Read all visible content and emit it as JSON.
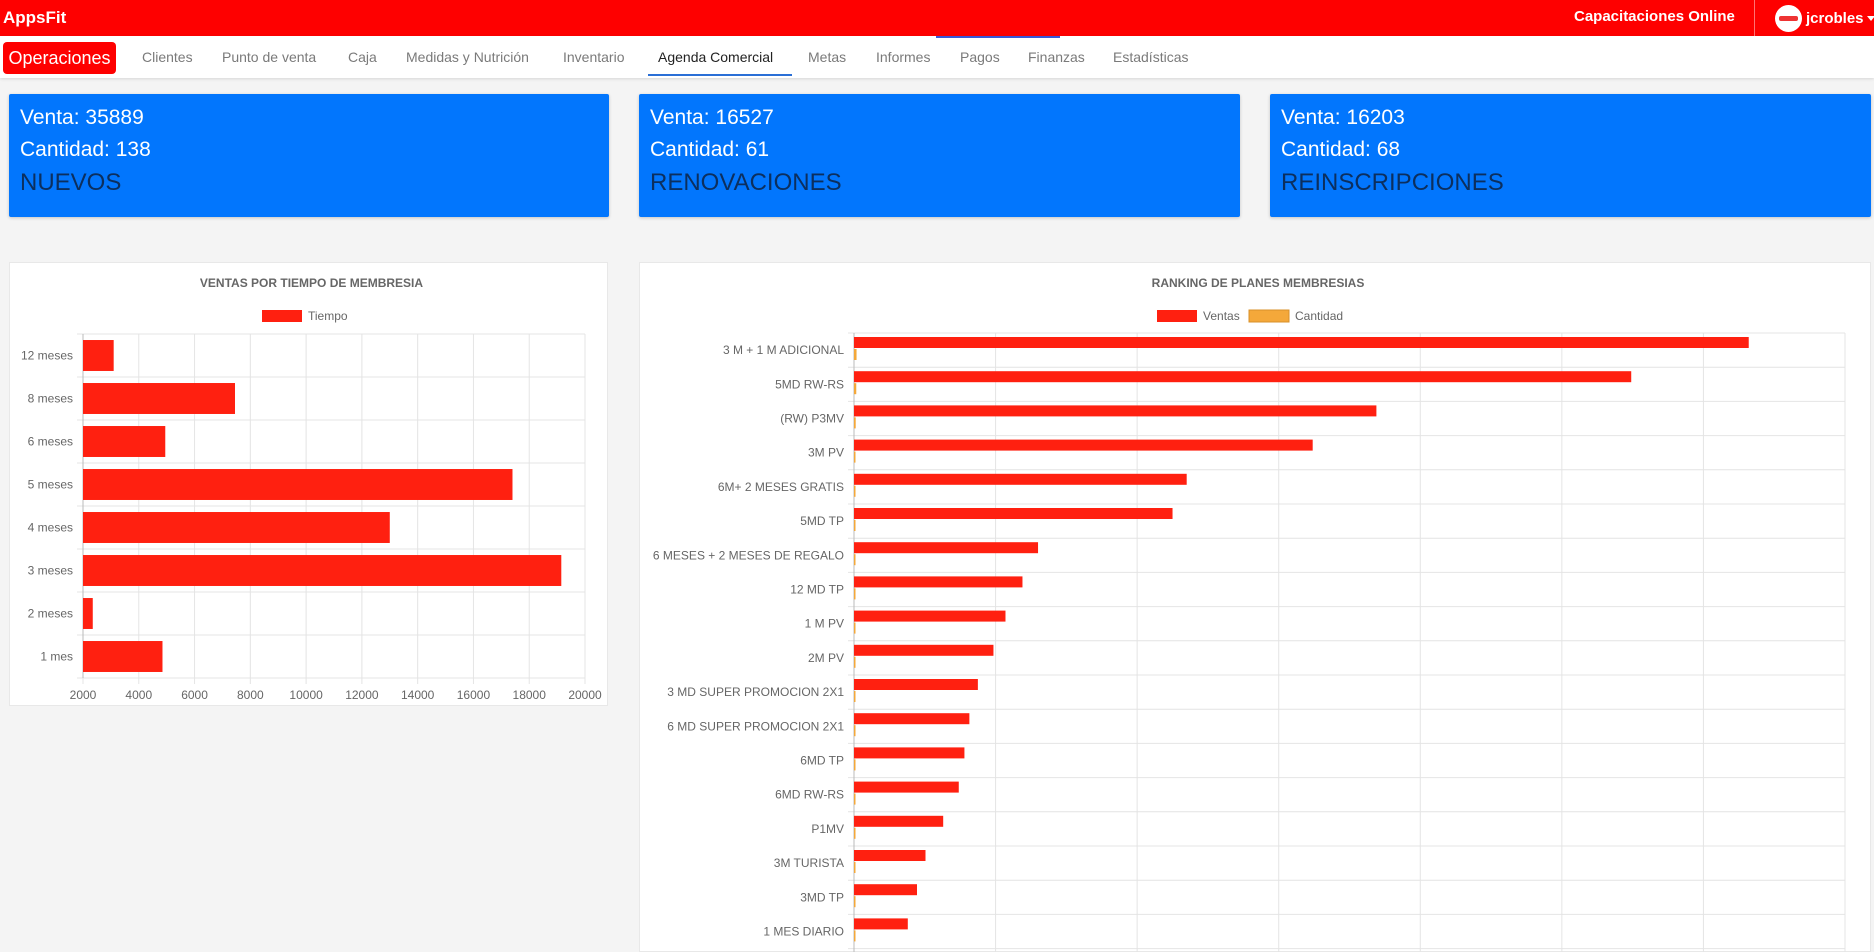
{
  "app": {
    "brand": "AppsFit"
  },
  "header": {
    "training_link": "Capacitaciones Online",
    "user_name": "jcrobles"
  },
  "nav": {
    "primary": "Operaciones",
    "items": [
      "Clientes",
      "Punto de venta",
      "Caja",
      "Medidas y Nutrición",
      "Inventario",
      "Agenda Comercial",
      "Metas",
      "Informes",
      "Pagos",
      "Finanzas",
      "Estadísticas"
    ],
    "active": "Agenda Comercial"
  },
  "cards": [
    {
      "venta": "Venta: 35889",
      "cantidad": "Cantidad: 138",
      "label": "NUEVOS"
    },
    {
      "venta": "Venta: 16527",
      "cantidad": "Cantidad: 61",
      "label": "RENOVACIONES"
    },
    {
      "venta": "Venta: 16203",
      "cantidad": "Cantidad: 68",
      "label": "REINSCRIPCIONES"
    }
  ],
  "colors": {
    "topbar": "#fe0000",
    "card": "#0276fd",
    "bar_ventas": "#ff2010",
    "bar_cantidad": "#f4a83a"
  },
  "chart_data": [
    {
      "type": "bar",
      "orientation": "horizontal",
      "title": "VENTAS POR TIEMPO DE MEMBRESIA",
      "categories": [
        "12 meses",
        "8 meses",
        "6  meses",
        "5 meses",
        "4 meses",
        "3 meses",
        "2 meses",
        "1 mes"
      ],
      "series": [
        {
          "name": "Tiempo",
          "values": [
            3100,
            7450,
            4950,
            17400,
            13000,
            19150,
            2350,
            4850
          ]
        }
      ],
      "xlim": [
        2000,
        20000
      ],
      "xticks": [
        "2000",
        "4000",
        "6000",
        "8000",
        "10000",
        "12000",
        "14000",
        "16000",
        "18000",
        "20000"
      ],
      "grid": true,
      "legend": "top"
    },
    {
      "type": "bar",
      "orientation": "horizontal",
      "title": "RANKING DE PLANES MEMBRESIAS",
      "categories": [
        "3 M + 1 M ADICIONAL",
        "5MD RW-RS",
        "(RW) P3MV",
        "3M PV",
        "6M+ 2 MESES GRATIS",
        "5MD TP",
        "6 MESES + 2 MESES DE REGALO",
        "12 MD TP",
        "1 M PV",
        "2M PV",
        "3  MD SUPER PROMOCION 2X1",
        "6  MD SUPER PROMOCION 2X1",
        "6MD TP",
        "6MD RW-RS",
        "P1MV",
        "3M TURISTA",
        "3MD TP",
        "1 MES DIARIO"
      ],
      "series": [
        {
          "name": "Ventas",
          "values": [
            6320,
            5490,
            3690,
            3240,
            2350,
            2250,
            1300,
            1190,
            1070,
            985,
            875,
            815,
            780,
            740,
            630,
            505,
            445,
            380
          ]
        },
        {
          "name": "Cantidad",
          "values": [
            18,
            16,
            12,
            10,
            7,
            6,
            5,
            4,
            4,
            3,
            3,
            3,
            3,
            3,
            2,
            2,
            2,
            2
          ]
        }
      ],
      "grid": true,
      "legend": "top"
    }
  ]
}
